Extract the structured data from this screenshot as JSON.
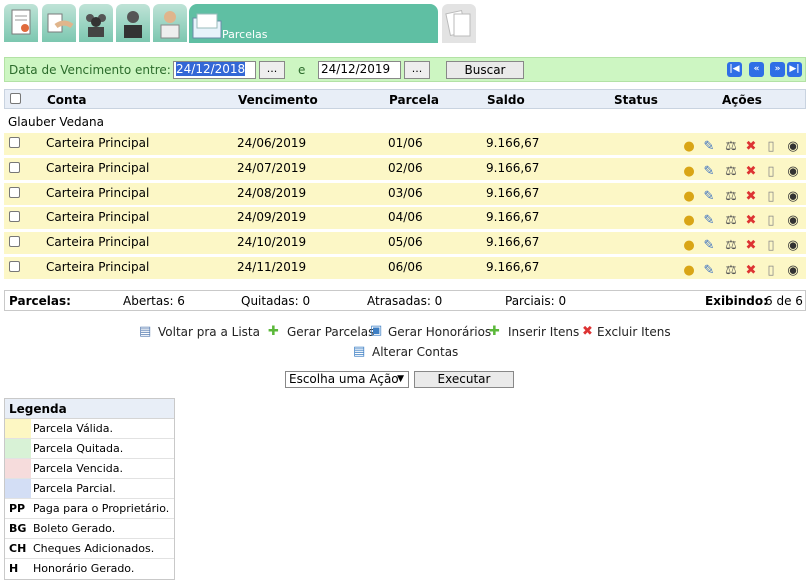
{
  "tabs": {
    "active_label": "Parcelas"
  },
  "filter": {
    "label": "Data de Vencimento entre:",
    "start_date": "24/12/2018",
    "and_label": "e",
    "end_date": "24/12/2019",
    "dots_label": "...",
    "search_label": "Buscar"
  },
  "table": {
    "headers": {
      "conta": "Conta",
      "vencimento": "Vencimento",
      "parcela": "Parcela",
      "saldo": "Saldo",
      "status": "Status",
      "acoes": "Ações"
    },
    "group": "Glauber Vedana",
    "rows": [
      {
        "conta": "Carteira Principal",
        "vencimento": "24/06/2019",
        "parcela": "01/06",
        "saldo": "9.166,67"
      },
      {
        "conta": "Carteira Principal",
        "vencimento": "24/07/2019",
        "parcela": "02/06",
        "saldo": "9.166,67"
      },
      {
        "conta": "Carteira Principal",
        "vencimento": "24/08/2019",
        "parcela": "03/06",
        "saldo": "9.166,67"
      },
      {
        "conta": "Carteira Principal",
        "vencimento": "24/09/2019",
        "parcela": "04/06",
        "saldo": "9.166,67"
      },
      {
        "conta": "Carteira Principal",
        "vencimento": "24/10/2019",
        "parcela": "05/06",
        "saldo": "9.166,67"
      },
      {
        "conta": "Carteira Principal",
        "vencimento": "24/11/2019",
        "parcela": "06/06",
        "saldo": "9.166,67"
      }
    ]
  },
  "summary": {
    "parcelas": "Parcelas:",
    "abertas": "Abertas: 6",
    "quitadas": "Quitadas: 0",
    "atrasadas": "Atrasadas: 0",
    "parciais": "Parciais: 0",
    "exibindo_label": "Exibindo:",
    "exibindo_value": "6 de 6"
  },
  "actions": {
    "voltar": "Voltar pra a Lista",
    "gerar_parcelas": "Gerar Parcelas",
    "gerar_honorarios": "Gerar Honorários",
    "inserir_itens": "Inserir Itens",
    "excluir_itens": "Excluir Itens",
    "alterar_contas": "Alterar Contas",
    "select_value": "Escolha uma Ação",
    "execute": "Executar"
  },
  "legend": {
    "title": "Legenda",
    "items": [
      {
        "code": "",
        "color": "#fdf7c3",
        "text": "Parcela Válida."
      },
      {
        "code": "",
        "color": "#d8f2d6",
        "text": "Parcela Quitada."
      },
      {
        "code": "",
        "color": "#f6dcdc",
        "text": "Parcela Vencida."
      },
      {
        "code": "",
        "color": "#d3def5",
        "text": "Parcela Parcial."
      },
      {
        "code": "PP",
        "color": "",
        "text": "Paga para o Proprietário."
      },
      {
        "code": "BG",
        "color": "",
        "text": "Boleto Gerado."
      },
      {
        "code": "CH",
        "color": "",
        "text": "Cheques Adicionados."
      },
      {
        "code": "H",
        "color": "",
        "text": "Honorário Gerado."
      }
    ]
  }
}
